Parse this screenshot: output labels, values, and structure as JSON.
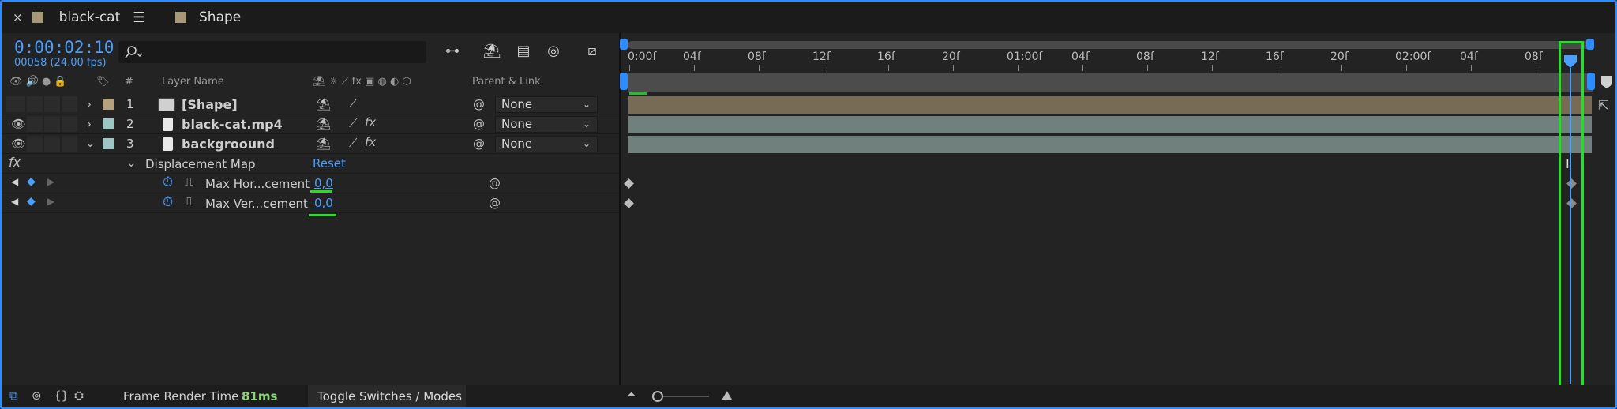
{
  "tabs": [
    {
      "label": "black-cat",
      "color": "#a89877",
      "active": true
    },
    {
      "label": "Shape",
      "color": "#a89877",
      "active": false
    }
  ],
  "time": {
    "timecode": "0:00:02:10",
    "frames": "00058 (24.00 fps)"
  },
  "columns": {
    "hash": "#",
    "layer_name": "Layer Name",
    "parent_link": "Parent & Link"
  },
  "layers": [
    {
      "index": "1",
      "name": "[Shape]",
      "label_color": "#b5a27e",
      "parent": "None"
    },
    {
      "index": "2",
      "name": "black-cat.mp4",
      "label_color": "#9cc7c4",
      "parent": "None"
    },
    {
      "index": "3",
      "name": "backgroound",
      "label_color": "#9cc7c4",
      "parent": "None"
    }
  ],
  "effect": {
    "fx_label": "fx",
    "name": "Displacement Map",
    "reset": "Reset"
  },
  "properties": [
    {
      "name": "Max Hor...cement",
      "value": "0,0"
    },
    {
      "name": "Max Ver...cement",
      "value": "0,0"
    }
  ],
  "ruler": {
    "ticks": [
      "0:00f",
      "04f",
      "08f",
      "12f",
      "16f",
      "20f",
      "01:00f",
      "04f",
      "08f",
      "12f",
      "16f",
      "20f",
      "02:00f",
      "04f",
      "08f"
    ]
  },
  "status": {
    "render_label": "Frame Render Time",
    "render_value": "81ms",
    "toggle": "Toggle Switches / Modes"
  },
  "colors": {
    "accent": "#4a9fff",
    "highlight": "#22e022",
    "shape_bar": "#776b55",
    "video_bar": "#6f807d"
  }
}
